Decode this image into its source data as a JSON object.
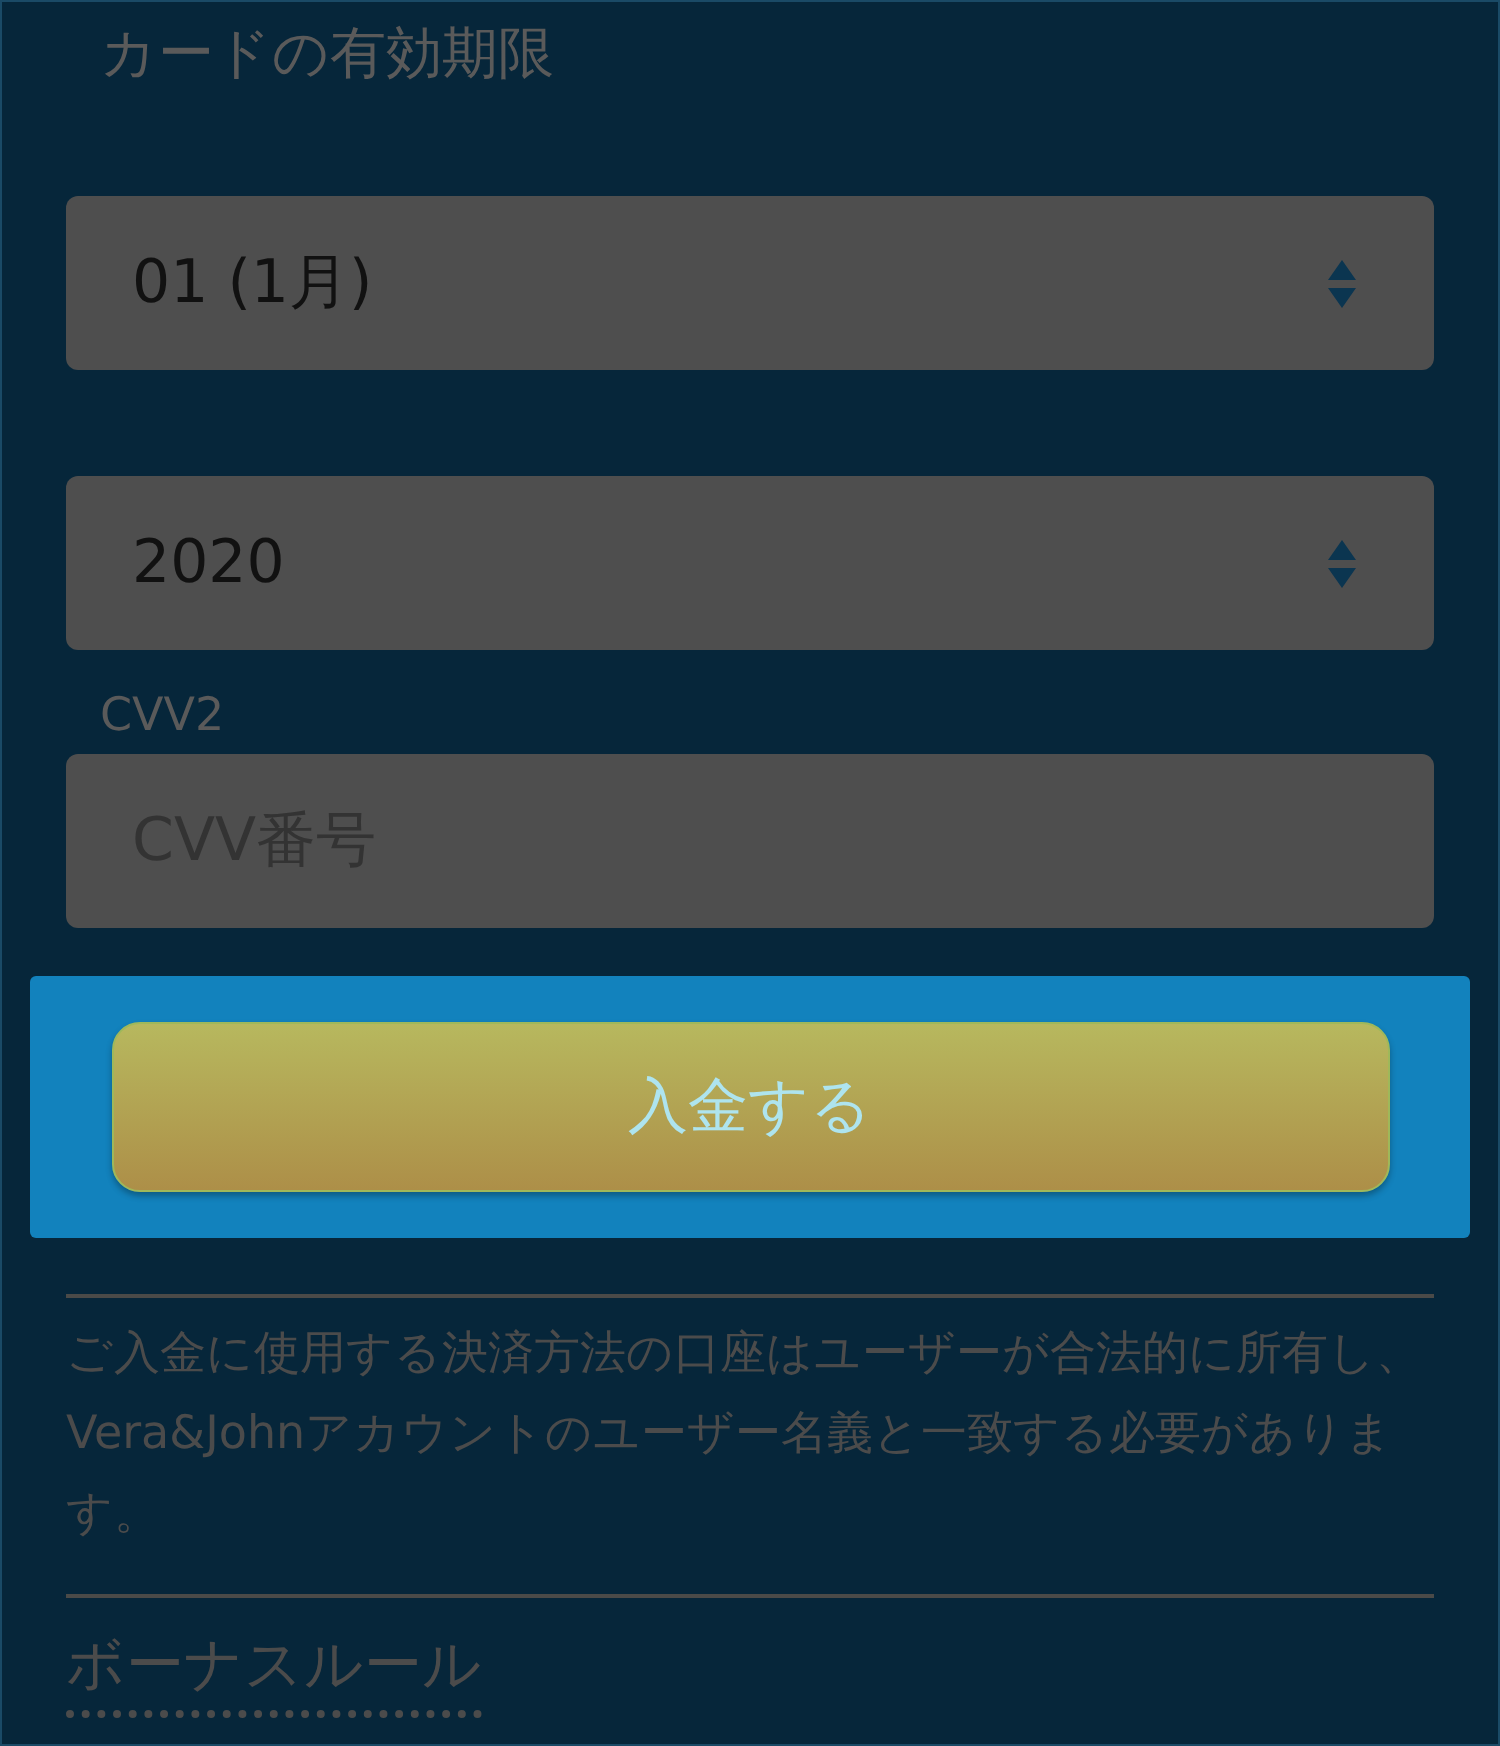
{
  "expiry": {
    "label": "カードの有効期限",
    "selects": [
      {
        "value": "01 (1月)"
      },
      {
        "value": "2020"
      }
    ]
  },
  "cvv": {
    "label": "CVV2",
    "placeholder": "CVV番号"
  },
  "deposit_button": "入金する",
  "notice": "ご入金に使用する決済方法の口座はユーザーが合法的に所有し、Vera&Johnアカウントのユーザー名義と一致する必要があります。",
  "bonus_link": "ボーナスルール"
}
